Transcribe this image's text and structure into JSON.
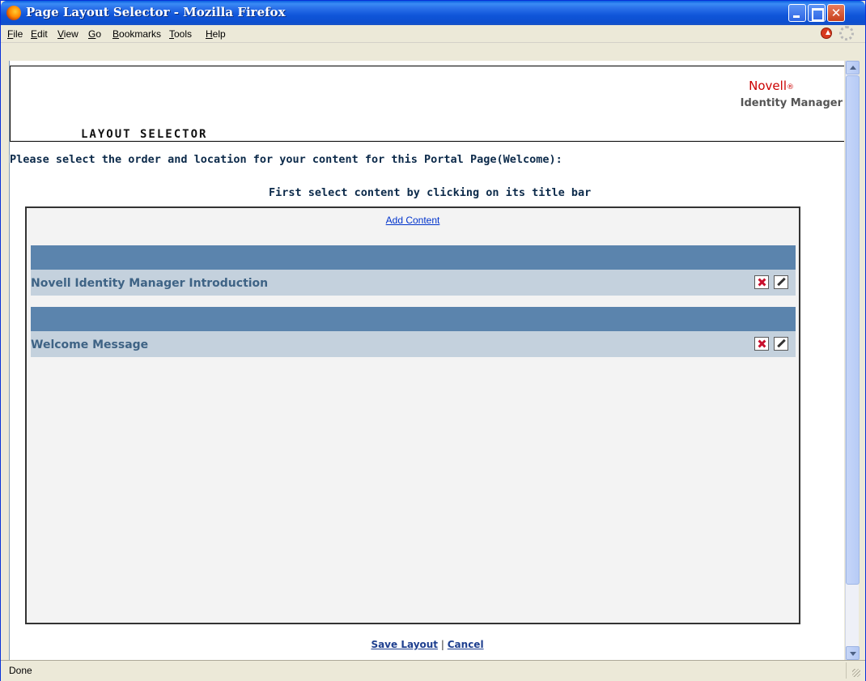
{
  "window": {
    "title": "Page Layout Selector - Mozilla Firefox"
  },
  "menubar": {
    "items": [
      {
        "label": "File",
        "accel": "F",
        "rest": "ile"
      },
      {
        "label": "Edit",
        "accel": "E",
        "rest": "dit"
      },
      {
        "label": "View",
        "accel": "V",
        "rest": "iew"
      },
      {
        "label": "Go",
        "accel": "G",
        "rest": "o"
      },
      {
        "label": "Bookmarks",
        "accel": "B",
        "rest": "ookmarks"
      },
      {
        "label": "Tools",
        "accel": "T",
        "rest": "ools"
      },
      {
        "label": "Help",
        "accel": "H",
        "rest": "elp"
      }
    ]
  },
  "header": {
    "brand": "Novell",
    "brand_mark": "®",
    "product": "Identity Manager",
    "title": "LAYOUT SELECTOR"
  },
  "instructions": {
    "line1": "Please select the order and location for your content for this Portal Page(Welcome):",
    "line2": "First select content by clicking on its title bar"
  },
  "layout": {
    "add_content": "Add Content",
    "portlets": [
      {
        "title": "Novell Identity Manager Introduction"
      },
      {
        "title": "Welcome Message"
      }
    ]
  },
  "actions": {
    "save": "Save Layout",
    "separator": "|",
    "cancel": "Cancel"
  },
  "status": {
    "text": "Done"
  },
  "icons": {
    "app": "firefox-icon",
    "remove": "remove-icon",
    "edit": "edit-icon",
    "stop": "stop-icon",
    "throbber": "throbber-icon"
  },
  "colors": {
    "titlebar": "#0d4fcf",
    "portlet_header": "#5b84ad",
    "portlet_bar": "#c4d1dd",
    "brand": "#cc0000",
    "link": "#1e3f8f"
  }
}
